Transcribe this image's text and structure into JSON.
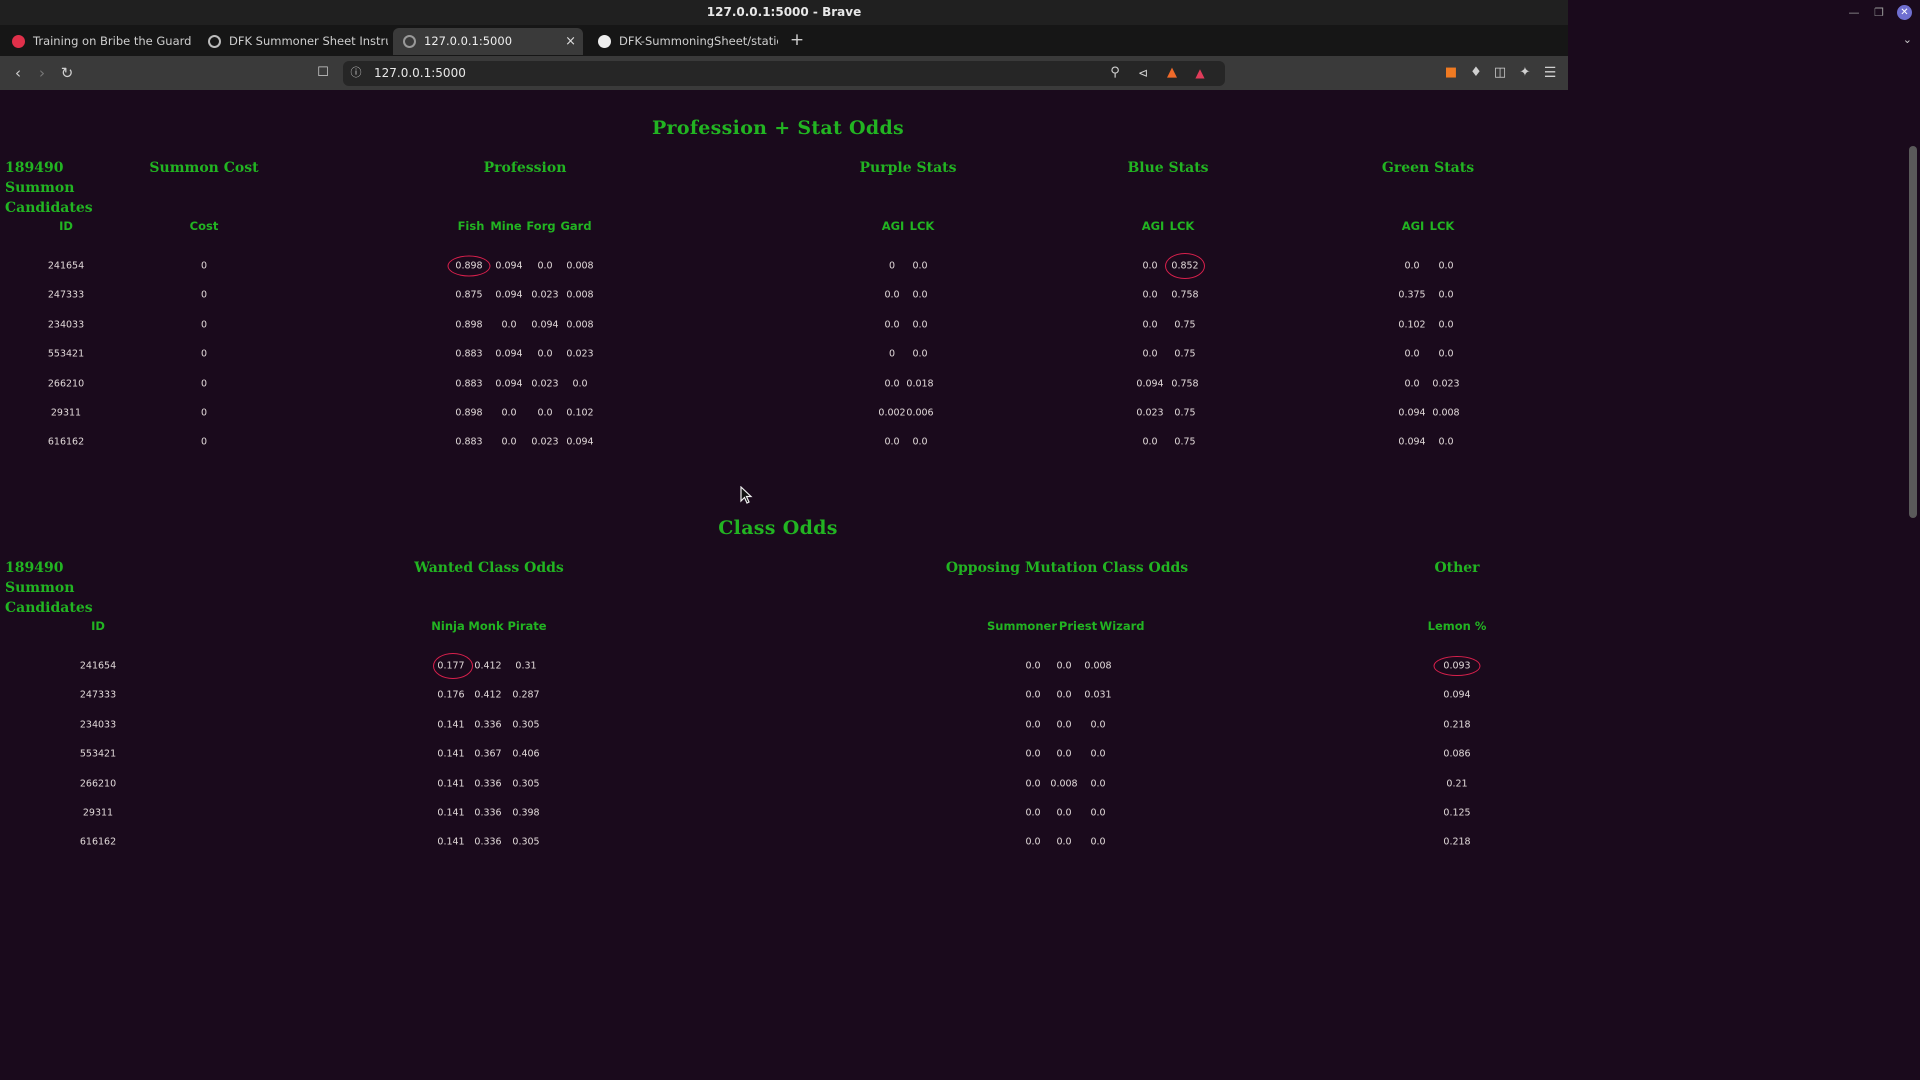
{
  "window": {
    "title": "127.0.0.1:5000 - Brave"
  },
  "tabs": [
    {
      "label": "Training on Bribe the Guards of",
      "icon": "red-circle-icon"
    },
    {
      "label": "DFK Summoner Sheet Instructio",
      "icon": "globe-icon"
    },
    {
      "label": "127.0.0.1:5000",
      "icon": "globe-icon"
    },
    {
      "label": "DFK-SummoningSheet/static/c",
      "icon": "github-icon"
    }
  ],
  "address_bar": {
    "url": "127.0.0.1:5000"
  },
  "section1": {
    "title": "Profession + Stat Odds",
    "col_candidates": "189490 Summon Candidates",
    "col_cost": "Summon Cost",
    "col_profession": "Profession",
    "col_purple": "Purple Stats",
    "col_blue": "Blue Stats",
    "col_green": "Green Stats",
    "sub_id": "ID",
    "sub_cost": "Cost",
    "sub_profession": [
      "Fish",
      "Mine",
      "Forg",
      "Gard"
    ],
    "sub_purple": [
      "AGI",
      "LCK"
    ],
    "sub_blue": [
      "AGI",
      "LCK"
    ],
    "sub_green": [
      "AGI",
      "LCK"
    ],
    "rows": [
      {
        "id": "241654",
        "cost": "0",
        "profession": [
          "0.898",
          "0.094",
          "0.0",
          "0.008"
        ],
        "purple": [
          "0",
          "0.0"
        ],
        "blue": [
          "0.0",
          "0.852"
        ],
        "green": [
          "0.0",
          "0.0"
        ]
      },
      {
        "id": "247333",
        "cost": "0",
        "profession": [
          "0.875",
          "0.094",
          "0.023",
          "0.008"
        ],
        "purple": [
          "0.0",
          "0.0"
        ],
        "blue": [
          "0.0",
          "0.758"
        ],
        "green": [
          "0.375",
          "0.0"
        ]
      },
      {
        "id": "234033",
        "cost": "0",
        "profession": [
          "0.898",
          "0.0",
          "0.094",
          "0.008"
        ],
        "purple": [
          "0.0",
          "0.0"
        ],
        "blue": [
          "0.0",
          "0.75"
        ],
        "green": [
          "0.102",
          "0.0"
        ]
      },
      {
        "id": "553421",
        "cost": "0",
        "profession": [
          "0.883",
          "0.094",
          "0.0",
          "0.023"
        ],
        "purple": [
          "0",
          "0.0"
        ],
        "blue": [
          "0.0",
          "0.75"
        ],
        "green": [
          "0.0",
          "0.0"
        ]
      },
      {
        "id": "266210",
        "cost": "0",
        "profession": [
          "0.883",
          "0.094",
          "0.023",
          "0.0"
        ],
        "purple": [
          "0.0",
          "0.018"
        ],
        "blue": [
          "0.094",
          "0.758"
        ],
        "green": [
          "0.0",
          "0.023"
        ]
      },
      {
        "id": "29311",
        "cost": "0",
        "profession": [
          "0.898",
          "0.0",
          "0.0",
          "0.102"
        ],
        "purple": [
          "0.002",
          "0.006"
        ],
        "blue": [
          "0.023",
          "0.75"
        ],
        "green": [
          "0.094",
          "0.008"
        ]
      },
      {
        "id": "616162",
        "cost": "0",
        "profession": [
          "0.883",
          "0.0",
          "0.023",
          "0.094"
        ],
        "purple": [
          "0.0",
          "0.0"
        ],
        "blue": [
          "0.0",
          "0.75"
        ],
        "green": [
          "0.094",
          "0.0"
        ]
      }
    ]
  },
  "section2": {
    "title": "Class Odds",
    "col_candidates": "189490 Summon Candidates",
    "col_wanted": "Wanted Class Odds",
    "col_opposing": "Opposing Mutation Class Odds",
    "col_other": "Other",
    "sub_id": "ID",
    "sub_wanted": [
      "Ninja",
      "Monk",
      "Pirate"
    ],
    "sub_opposing": [
      "Summoner",
      "Priest",
      "Wizard"
    ],
    "sub_other": "Lemon %",
    "rows": [
      {
        "id": "241654",
        "wanted": [
          "0.177",
          "0.412",
          "0.31"
        ],
        "opposing": [
          "0.0",
          "0.0",
          "0.008"
        ],
        "lemon": "0.093"
      },
      {
        "id": "247333",
        "wanted": [
          "0.176",
          "0.412",
          "0.287"
        ],
        "opposing": [
          "0.0",
          "0.0",
          "0.031"
        ],
        "lemon": "0.094"
      },
      {
        "id": "234033",
        "wanted": [
          "0.141",
          "0.336",
          "0.305"
        ],
        "opposing": [
          "0.0",
          "0.0",
          "0.0"
        ],
        "lemon": "0.218"
      },
      {
        "id": "553421",
        "wanted": [
          "0.141",
          "0.367",
          "0.406"
        ],
        "opposing": [
          "0.0",
          "0.0",
          "0.0"
        ],
        "lemon": "0.086"
      },
      {
        "id": "266210",
        "wanted": [
          "0.141",
          "0.336",
          "0.305"
        ],
        "opposing": [
          "0.0",
          "0.008",
          "0.0"
        ],
        "lemon": "0.21"
      },
      {
        "id": "29311",
        "wanted": [
          "0.141",
          "0.336",
          "0.398"
        ],
        "opposing": [
          "0.0",
          "0.0",
          "0.0"
        ],
        "lemon": "0.125"
      },
      {
        "id": "616162",
        "wanted": [
          "0.141",
          "0.336",
          "0.305"
        ],
        "opposing": [
          "0.0",
          "0.0",
          "0.0"
        ],
        "lemon": "0.218"
      }
    ]
  },
  "colors": {
    "heading": "#22b422",
    "page_bg": "#1a0a1c",
    "highlight": "#d8204c"
  }
}
